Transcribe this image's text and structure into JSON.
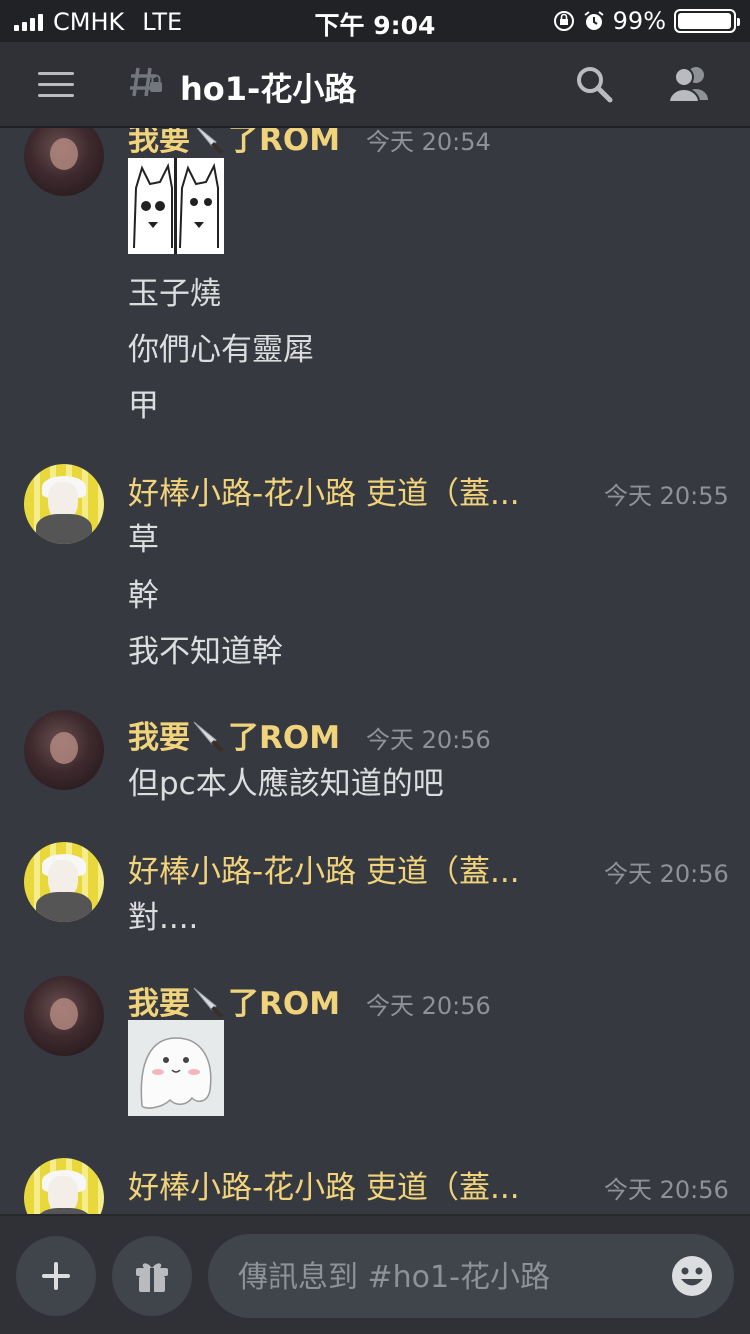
{
  "status_bar": {
    "carrier": "CMHK",
    "network": "LTE",
    "time": "下午 9:04",
    "battery_percent_text": "99%",
    "battery_level": 0.99
  },
  "header": {
    "channel_name": "ho1-花小路",
    "channel_glyph": "#"
  },
  "messages": [
    {
      "user": "我要🔪了ROM",
      "user_parts": [
        "我要",
        "了ROM"
      ],
      "timestamp": "今天 20:54",
      "sticker": "cats",
      "lines": [
        "玉子燒",
        "你們心有靈犀",
        "甲"
      ]
    },
    {
      "user": "好棒小路-花小路 吏道（蓋...",
      "timestamp": "今天 20:55",
      "lines": [
        "草",
        "幹",
        "我不知道幹"
      ]
    },
    {
      "user": "我要🔪了ROM",
      "user_parts": [
        "我要",
        "了ROM"
      ],
      "timestamp": "今天 20:56",
      "lines": [
        "但pc本人應該知道的吧"
      ]
    },
    {
      "user": "好棒小路-花小路 吏道（蓋...",
      "timestamp": "今天 20:56",
      "lines": [
        "對...."
      ]
    },
    {
      "user": "我要🔪了ROM",
      "user_parts": [
        "我要",
        "了ROM"
      ],
      "timestamp": "今天 20:56",
      "sticker": "ghost",
      "lines": []
    },
    {
      "user": "好棒小路-花小路 吏道（蓋...",
      "timestamp": "今天 20:56",
      "lines": []
    }
  ],
  "composer": {
    "placeholder": "傳訊息到 #ho1-花小路"
  },
  "icons": [
    "menu-icon",
    "channel-hash-lock-icon",
    "search-icon",
    "members-icon",
    "knife-icon",
    "plus-icon",
    "gift-icon",
    "emoji-icon"
  ],
  "colors": {
    "background": "#36393f",
    "header": "#2f3136",
    "username": "#f1d37c",
    "timestamp": "#8e9297",
    "text": "#dcddde"
  }
}
